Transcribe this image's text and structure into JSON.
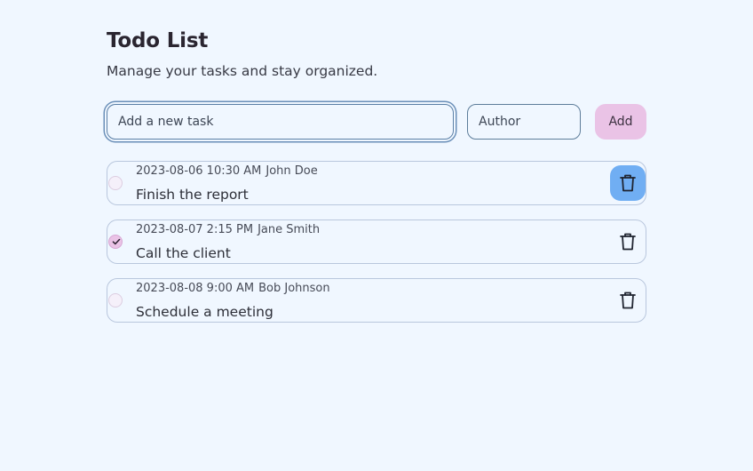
{
  "header": {
    "title": "Todo List",
    "subtitle": "Manage your tasks and stay organized."
  },
  "form": {
    "task_placeholder": "Add a new task",
    "author_placeholder": "Author",
    "add_label": "Add"
  },
  "tasks": [
    {
      "timestamp": "2023-08-06 10:30 AM",
      "author": "John Doe",
      "text": "Finish the report",
      "completed": false
    },
    {
      "timestamp": "2023-08-07 2:15 PM",
      "author": "Jane Smith",
      "text": "Call the client",
      "completed": true
    },
    {
      "timestamp": "2023-08-08 9:00 AM",
      "author": "Bob Johnson",
      "text": "Schedule a meeting",
      "completed": false
    }
  ],
  "colors": {
    "background": "#f0f7ff",
    "add_button": "#eac3e6",
    "delete_hover": "#70aef3",
    "checked": "#eac3e6"
  },
  "icons": {
    "delete": "trash-icon",
    "check": "check-icon"
  }
}
